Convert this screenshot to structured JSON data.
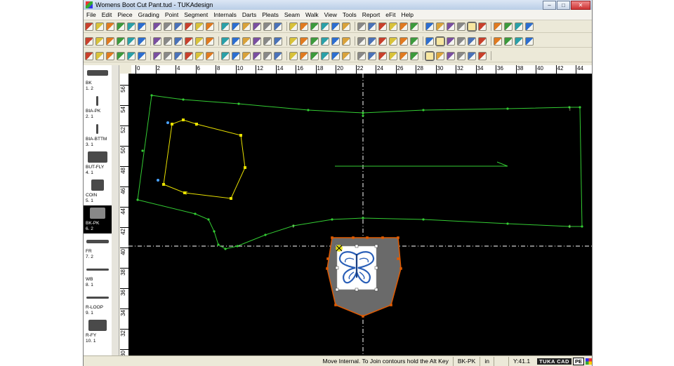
{
  "window": {
    "title": "Womens Boot Cut Pant.tud - TUKAdesign",
    "controls": [
      "–",
      "□",
      "✕"
    ]
  },
  "menu": [
    "File",
    "Edit",
    "Piece",
    "Grading",
    "Point",
    "Segment",
    "Internals",
    "Darts",
    "Pleats",
    "Seam",
    "Walk",
    "View",
    "Tools",
    "Report",
    "eFit",
    "Help"
  ],
  "toolbar_colors": [
    "#4a72b8",
    "#d9a23a",
    "#3c9a3c",
    "#c8402c",
    "#7a4fa0",
    "#2aa0a8",
    "#d8c23a",
    "#888888",
    "#2c6ed0",
    "#e07a20"
  ],
  "pieces": [
    {
      "name": "BK",
      "id": "1. 2"
    },
    {
      "name": "BIA-PK",
      "id": "2. 1"
    },
    {
      "name": "BIA-BTTM",
      "id": "3. 1"
    },
    {
      "name": "BUT-FLY",
      "id": "4. 1"
    },
    {
      "name": "COIN",
      "id": "5. 1"
    },
    {
      "name": "BK-PK",
      "id": "6. 2"
    },
    {
      "name": "FR",
      "id": "7. 2"
    },
    {
      "name": "WB",
      "id": "8. 1"
    },
    {
      "name": "R-LOOP",
      "id": "9. 1"
    },
    {
      "name": "R-FY",
      "id": "10. 1"
    }
  ],
  "ruler_h": [
    "0",
    "2",
    "4",
    "6",
    "8",
    "10",
    "12",
    "14",
    "16",
    "18",
    "20",
    "22",
    "24",
    "26",
    "28",
    "30",
    "32",
    "34",
    "36",
    "38",
    "40",
    "42",
    "44"
  ],
  "ruler_v": [
    "56",
    "54",
    "52",
    "50",
    "48",
    "46",
    "44",
    "42",
    "40",
    "38",
    "36",
    "34",
    "32",
    "30"
  ],
  "colors": {
    "canvas": "#000000",
    "pattern_outline": "#33cc33",
    "pocket_outline": "#e8e000",
    "selected_piece": "#e05a00",
    "selected_fill": "#6a6a6a",
    "crosshair": "#ffffff",
    "butterfly": "#2a5fb8"
  },
  "status": {
    "message": "Move Internal. To Join contours hold the Alt Key",
    "piece": "BK-PK",
    "units": "in",
    "coord": "Y:41.1",
    "logo": "TUKA CAD",
    "logo_pe": "PE"
  }
}
